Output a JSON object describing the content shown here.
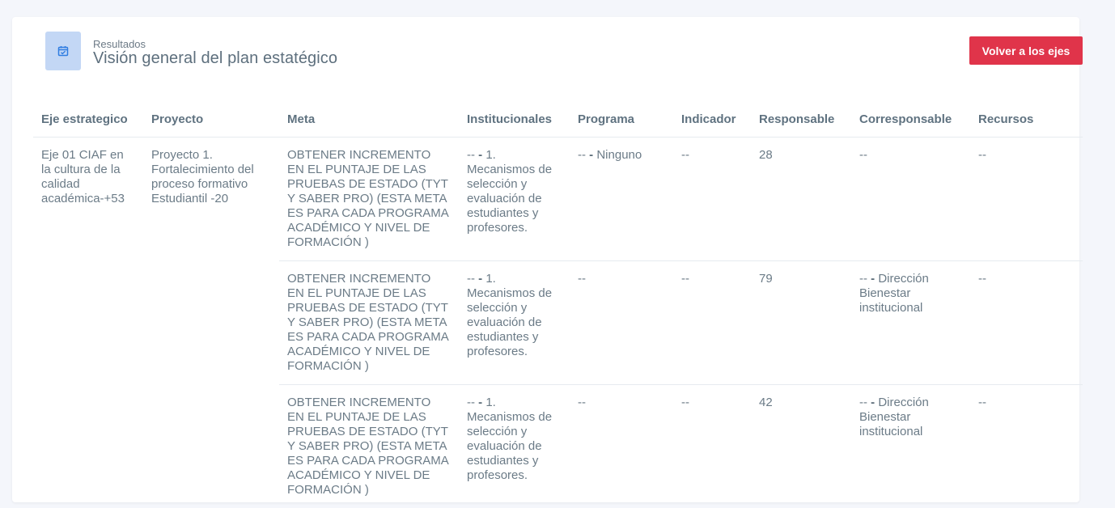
{
  "header": {
    "subtitle": "Resultados",
    "title": "Visión general del plan estatégico",
    "icon": "calendar-check-icon",
    "back_button_label": "Volver a los ejes"
  },
  "colors": {
    "accent_button": "#e0344a",
    "icon_bg": "#c3d7f5",
    "icon_fg": "#2f7de1"
  },
  "table": {
    "headers": {
      "eje": "Eje estrategico",
      "proyecto": "Proyecto",
      "meta": "Meta",
      "institucionales": "Institucionales",
      "programa": "Programa",
      "indicador": "Indicador",
      "responsable": "Responsable",
      "corresponsable": "Corresponsable",
      "recursos": "Recursos"
    },
    "eje": "Eje 01 CIAF en la cultura de la calidad académica-+53",
    "proyecto": "Proyecto 1. Fortalecimiento del proceso formativo Estudiantil -20",
    "rows": [
      {
        "meta": "OBTENER INCREMENTO EN EL PUNTAJE DE LAS PRUEBAS DE ESTADO (TYT Y SABER PRO) (ESTA META ES PARA CADA PROGRAMA ACADÉMICO Y NIVEL DE FORMACIÓN )",
        "institucionales_prefix": "--",
        "institucionales_sep": "-",
        "institucionales_text": "1. Mecanismos de selección y evaluación de estudiantes y profesores.",
        "programa_prefix": "--",
        "programa_sep": "-",
        "programa_text": "Ninguno",
        "indicador": "--",
        "responsable": "28",
        "corresponsable_prefix": "--",
        "corresponsable_sep": "",
        "corresponsable_text": "",
        "recursos": "--"
      },
      {
        "meta": "OBTENER INCREMENTO EN EL PUNTAJE DE LAS PRUEBAS DE ESTADO (TYT Y SABER PRO) (ESTA META ES PARA CADA PROGRAMA ACADÉMICO Y NIVEL DE FORMACIÓN )",
        "institucionales_prefix": "--",
        "institucionales_sep": "-",
        "institucionales_text": "1. Mecanismos de selección y evaluación de estudiantes y profesores.",
        "programa_prefix": "--",
        "programa_sep": "",
        "programa_text": "",
        "indicador": "--",
        "responsable": "79",
        "corresponsable_prefix": "--",
        "corresponsable_sep": "-",
        "corresponsable_text": "Dirección Bienestar institucional",
        "recursos": "--"
      },
      {
        "meta": "OBTENER INCREMENTO EN EL PUNTAJE DE LAS PRUEBAS DE ESTADO (TYT Y SABER PRO) (ESTA META ES PARA CADA PROGRAMA ACADÉMICO Y NIVEL DE FORMACIÓN )",
        "institucionales_prefix": "--",
        "institucionales_sep": "-",
        "institucionales_text": "1. Mecanismos de selección y evaluación de estudiantes y profesores.",
        "programa_prefix": "--",
        "programa_sep": "",
        "programa_text": "",
        "indicador": "--",
        "responsable": "42",
        "corresponsable_prefix": "--",
        "corresponsable_sep": "-",
        "corresponsable_text": "Dirección Bienestar institucional",
        "recursos": "--"
      }
    ]
  }
}
